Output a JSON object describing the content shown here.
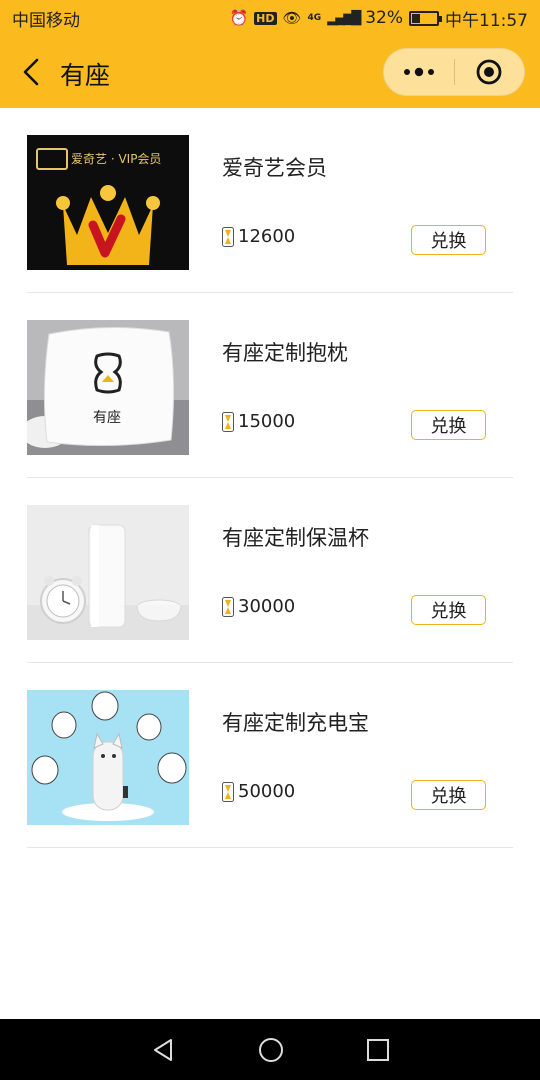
{
  "status_bar": {
    "carrier": "中国移动",
    "network": "4G",
    "battery": "32%",
    "battery_level": 0.32,
    "time": "中午11:57"
  },
  "nav": {
    "title": "有座",
    "bg_color": "#fbbb1f"
  },
  "items": [
    {
      "name": "爱奇艺会员",
      "points": "12600",
      "button": "兑换",
      "image": "iqiyi-vip",
      "banner": "爱奇艺 · VIP会员"
    },
    {
      "name": "有座定制抱枕",
      "points": "15000",
      "button": "兑换",
      "image": "pillow",
      "logo_text": "有座"
    },
    {
      "name": "有座定制保温杯",
      "points": "30000",
      "button": "兑换",
      "image": "thermos-cup"
    },
    {
      "name": "有座定制充电宝",
      "points": "50000",
      "button": "兑换",
      "image": "power-bank"
    }
  ],
  "colors": {
    "accent": "#fbbb1f",
    "button_border": "#f0b21a"
  }
}
